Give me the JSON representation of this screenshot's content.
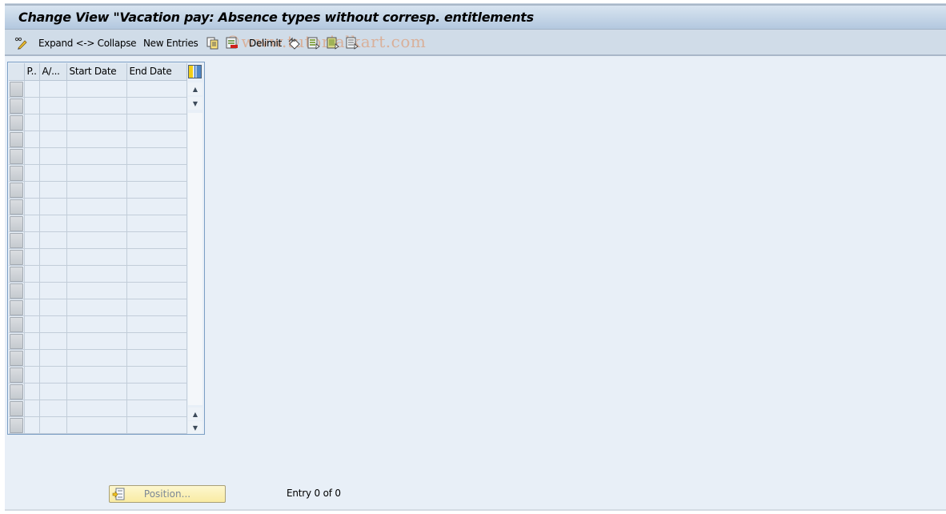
{
  "window": {
    "title": "Change View \"Vacation pay: Absence types without corresp. entitlements"
  },
  "toolbar": {
    "items": [
      {
        "name": "display-change-toggle",
        "icon": "pencil-glasses-icon",
        "label": ""
      },
      {
        "name": "expand-collapse",
        "label": "Expand <-> Collapse"
      },
      {
        "name": "new-entries",
        "label": "New Entries"
      },
      {
        "name": "copy-as",
        "icon": "copy-icon",
        "label": ""
      },
      {
        "name": "delete",
        "icon": "delete-icon",
        "label": ""
      },
      {
        "name": "delimit",
        "label": "Delimit"
      },
      {
        "name": "undo-change",
        "icon": "undo-icon",
        "label": ""
      },
      {
        "name": "select-all",
        "icon": "select-all-icon",
        "label": ""
      },
      {
        "name": "select-block",
        "icon": "select-block-icon",
        "label": ""
      },
      {
        "name": "deselect-all",
        "icon": "deselect-all-icon",
        "label": ""
      }
    ],
    "watermark": "©www.tutorialkart.com"
  },
  "table": {
    "columns": [
      "P..",
      "A/...",
      "Start Date",
      "End Date"
    ],
    "row_count": 21,
    "rows": []
  },
  "footer": {
    "position_button": "Position...",
    "entry_status": "Entry 0 of 0"
  }
}
